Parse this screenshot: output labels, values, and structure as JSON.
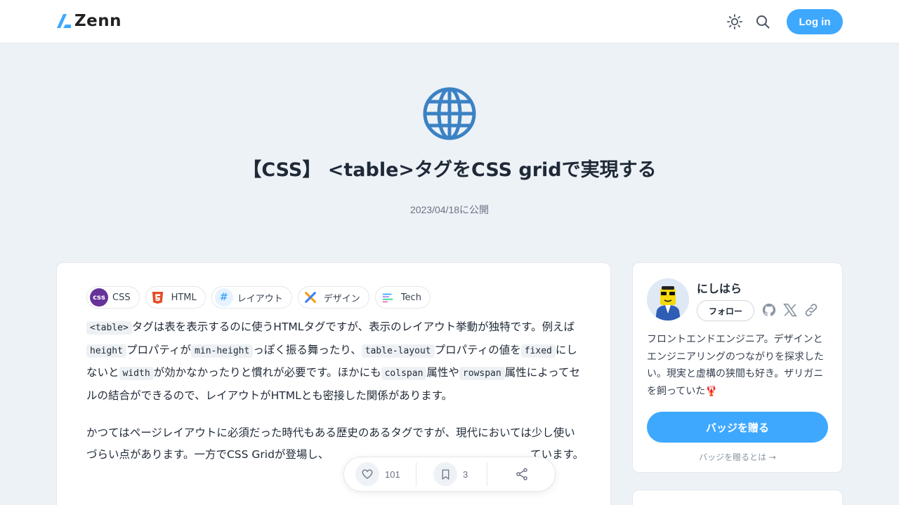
{
  "header": {
    "logo_text": "Zenn",
    "login_label": "Log in"
  },
  "article": {
    "title": "【CSS】 <table>タグをCSS gridで実現する",
    "published": "2023/04/18に公開",
    "tags": [
      {
        "label": "CSS",
        "icon": "css-icon"
      },
      {
        "label": "HTML",
        "icon": "html5-icon"
      },
      {
        "label": "レイアウト",
        "icon": "hashtag-icon"
      },
      {
        "label": "デザイン",
        "icon": "design-icon"
      },
      {
        "label": "Tech",
        "icon": "tech-icon"
      }
    ],
    "p1": {
      "c_table": "<table>",
      "t1": "タグは表を表示するのに使うHTMLタグですが、表示のレイアウト挙動が独特です。例えば",
      "c_height": "height",
      "t2": "プロパティが",
      "c_minheight": "min-height",
      "t3": "っぽく振る舞ったり、",
      "c_tablelayout": "table-layout",
      "t4": "プロパティの値を",
      "c_fixed": "fixed",
      "t5": "にしないと",
      "c_width": "width",
      "t6": "が効かなかったりと慣れが必要です。ほかにも",
      "c_colspan": "colspan",
      "t7": "属性や",
      "c_rowspan": "rowspan",
      "t8": "属性によってセルの結合ができるので、レイアウトがHTMLとも密接した関係があります。"
    },
    "p2": "かつてはページレイアウトに必須だった時代もある歴史のあるタグですが、現代においては少し使いづらい点があります。一方でCSS Gridが登場し、　　　　　　　　　　　　　　　　　　　ています。"
  },
  "actions": {
    "likes": "101",
    "bookmarks": "3"
  },
  "profile": {
    "name": "にしはら",
    "follow_label": "フォロー",
    "bio": "フロントエンドエンジニア。デザインとエンジニアリングのつながりを探求したい。現実と虚構の狭間も好き。ザリガニを飼っていた🦞",
    "badge_label": "バッジを贈る",
    "badge_link": "バッジを贈るとは →"
  },
  "colors": {
    "brand": "#3ea8ff",
    "background": "#edf2f7"
  }
}
